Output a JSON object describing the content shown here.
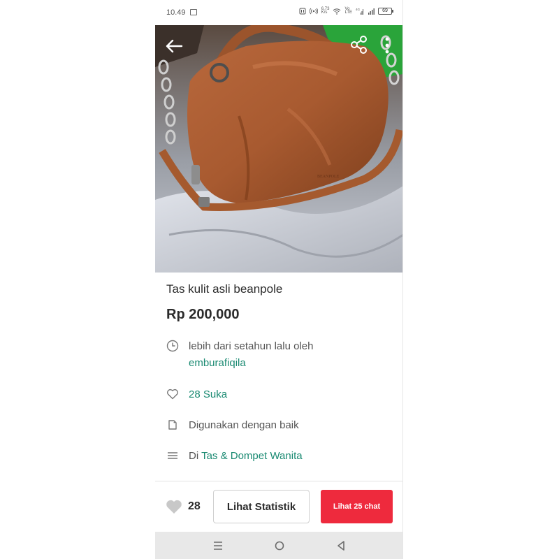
{
  "status_bar": {
    "time": "10.49",
    "icons": [
      "nfc-icon",
      "hotspot-icon",
      "data-speed-icon",
      "wifi-icon",
      "volte-icon",
      "signal-4g-icon",
      "signal-icon"
    ],
    "data_speed": "6.73\nK/s",
    "volte_label": "Vo\nLTE",
    "network_label": "4G",
    "battery_level": "69"
  },
  "hero": {
    "image_description_icon": "product-photo",
    "back_icon": "arrow-left-icon",
    "share_icon": "share-icon",
    "more_icon": "more-vertical-icon"
  },
  "listing": {
    "title": "Tas kulit asli beanpole",
    "price": "Rp 200,000",
    "posted_prefix": "lebih dari setahun lalu oleh",
    "seller": "emburafiqila",
    "likes_label": "28 Suka",
    "condition": "Digunakan dengan baik",
    "category_prefix": "Di",
    "category": "Tas & Dompet Wanita"
  },
  "actions": {
    "like_count": "28",
    "stats_button": "Lihat Statistik",
    "chat_button": "Lihat 25 chat"
  },
  "colors": {
    "accent_green": "#1a8a72",
    "chat_red": "#ee2a3d",
    "text_dark": "#2b2b2b"
  }
}
